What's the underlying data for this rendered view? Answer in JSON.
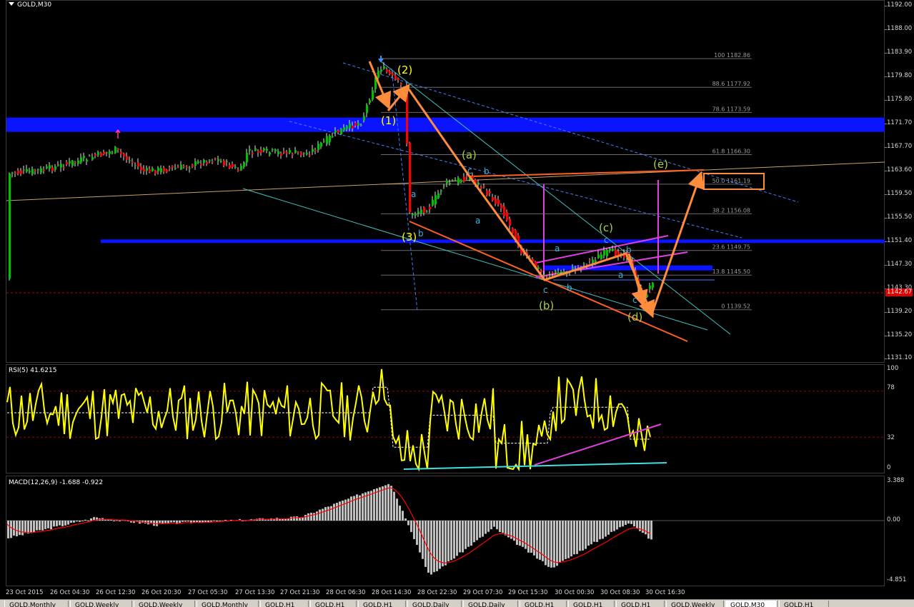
{
  "chart_data": {
    "type": "candlestick",
    "symbol_title": "GOLD,M30",
    "price_axis_labels": [
      "1192.00",
      "1188.00",
      "1183.90",
      "1179.80",
      "1175.80",
      "1171.70",
      "1167.70",
      "1163.60",
      "1159.50",
      "1155.50",
      "1151.40",
      "1147.30",
      "1143.30",
      "1139.20",
      "1135.20",
      "1131.10"
    ],
    "current_price_label": "1142.67",
    "time_axis_labels": [
      "23 Oct 2015",
      "26 Oct 04:30",
      "26 Oct 12:30",
      "26 Oct 20:30",
      "27 Oct 05:30",
      "27 Oct 13:30",
      "27 Oct 21:30",
      "28 Oct 06:30",
      "28 Oct 14:30",
      "28 Oct 22:30",
      "29 Oct 07:30",
      "29 Oct 15:30",
      "30 Oct 00:30",
      "30 Oct 08:30",
      "30 Oct 16:30"
    ],
    "fibonacci_levels": [
      {
        "label": "100 1182.86"
      },
      {
        "label": "88.6 1177.92"
      },
      {
        "label": "78.6 1173.59"
      },
      {
        "label": "61.8 1166.30"
      },
      {
        "label": "50.0 1161.19"
      },
      {
        "label": "38.2 1156.08"
      },
      {
        "label": "23.6 1149.75"
      },
      {
        "label": "13.8 1145.50"
      },
      {
        "label": "0 1139.52"
      }
    ],
    "wave_labels": {
      "major": [
        "(1)",
        "(2)",
        "(3)"
      ],
      "correction": [
        "(a)",
        "(b)",
        "(c)",
        "(d)",
        "(e)"
      ],
      "sub": [
        "a",
        "b",
        "c",
        "a",
        "b",
        "c",
        "a",
        "b",
        "c",
        "a",
        "b",
        "c"
      ]
    },
    "rsi": {
      "title": "RSI(5) 41.6215",
      "axis_labels": [
        "100",
        "78",
        "32",
        "0"
      ]
    },
    "macd": {
      "title": "MACD(12,26,9) -1.688 -0.922",
      "axis_labels": [
        "3.388",
        "0.00",
        "-4.851"
      ]
    },
    "colors": {
      "bull_candle": "#00c000",
      "bear_candle": "#ff0000",
      "wave_arrow": "#ff8c3a",
      "zone": "#0a14ff",
      "rsi_line": "#ffff00",
      "macd_signal": "#ff0000",
      "macd_hist": "#c0c0c0"
    }
  },
  "tabs": [
    "GOLD,Monthly",
    "GOLD,Weekly",
    "GOLD,Weekly",
    "GOLD,Monthly",
    "GOLD,H1",
    "GOLD,H1",
    "GOLD,H1",
    "GOLD,Daily",
    "GOLD,Daily",
    "GOLD,H1",
    "GOLD,H1",
    "GOLD,H1",
    "GOLD,Weekly",
    "GOLD,M30",
    "GOLD,H1"
  ]
}
